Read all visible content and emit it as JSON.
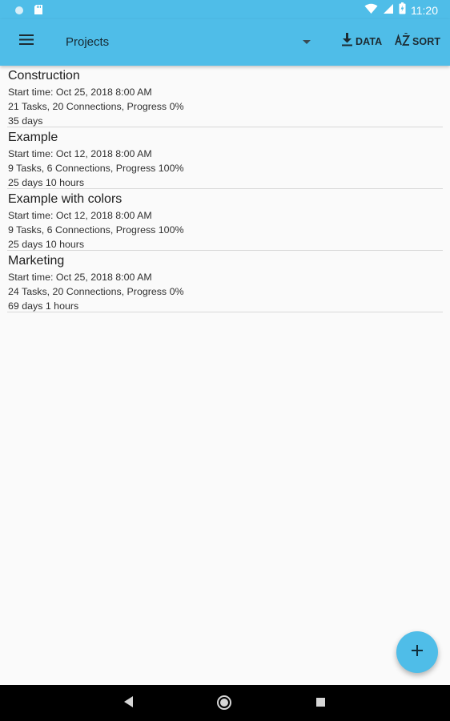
{
  "status_bar": {
    "time": "11:20",
    "icons": [
      "notification-circle-icon",
      "sd-card-icon",
      "wifi-icon",
      "signal-icon",
      "battery-icon"
    ]
  },
  "app_bar": {
    "menu_icon": "hamburger-menu-icon",
    "project_selector": {
      "selected": "Projects"
    },
    "actions": {
      "data_label": "DATA",
      "data_icon": "download-icon",
      "sort_label": "SORT",
      "sort_icon": "az-sort-icon"
    },
    "background_color": "#4fbde8"
  },
  "projects": [
    {
      "name": "Construction",
      "start": "Start time: Oct 25, 2018 8:00 AM",
      "summary": "21 Tasks, 20 Connections, Progress 0%",
      "duration": "35 days"
    },
    {
      "name": "Example",
      "start": "Start time: Oct 12, 2018 8:00 AM",
      "summary": "9 Tasks, 6 Connections, Progress 100%",
      "duration": "25 days 10 hours"
    },
    {
      "name": "Example with colors",
      "start": "Start time: Oct 12, 2018 8:00 AM",
      "summary": "9 Tasks, 6 Connections, Progress 100%",
      "duration": "25 days 10 hours"
    },
    {
      "name": "Marketing",
      "start": "Start time: Oct 25, 2018 8:00 AM",
      "summary": "24 Tasks, 20 Connections, Progress 0%",
      "duration": "69 days 1 hours"
    }
  ],
  "fab": {
    "icon": "plus-icon",
    "color": "#4fbde8"
  },
  "navigation_bar": {
    "icons": [
      "back-icon",
      "home-icon",
      "recents-icon"
    ]
  }
}
